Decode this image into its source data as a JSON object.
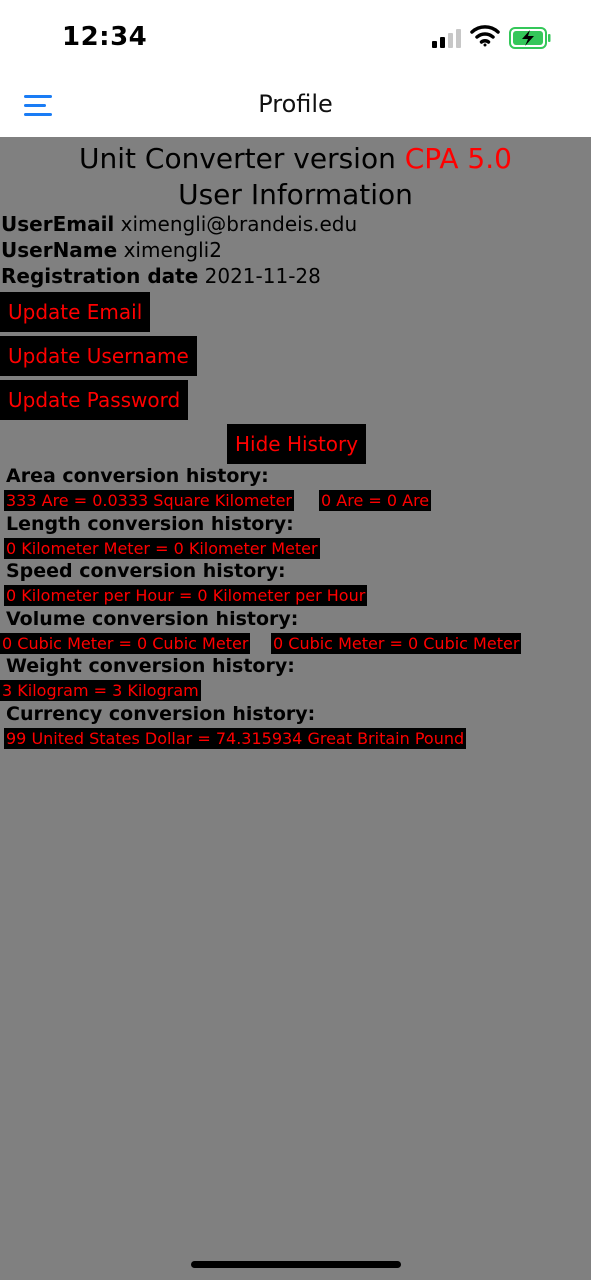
{
  "status_bar": {
    "time": "12:34"
  },
  "nav": {
    "title": "Profile"
  },
  "header": {
    "title_prefix": "Unit Converter version ",
    "version": "CPA 5.0",
    "subtitle": "User Information"
  },
  "user": {
    "email_label": "UserEmail",
    "email": "ximengli@brandeis.edu",
    "name_label": "UserName",
    "name": "ximengli2",
    "date_label": "Registration date",
    "date": "2021-11-28"
  },
  "buttons": {
    "update_email": "Update Email",
    "update_username": "Update Username",
    "update_password": "Update Password",
    "hide_history": "Hide History"
  },
  "history": {
    "area_label": "Area conversion history:",
    "area": [
      "333 Are = 0.0333 Square Kilometer",
      "0 Are = 0 Are"
    ],
    "length_label": "Length conversion history:",
    "length": [
      "0 Kilometer Meter = 0 Kilometer Meter"
    ],
    "speed_label": "Speed conversion history:",
    "speed": [
      "0 Kilometer per Hour = 0 Kilometer per Hour"
    ],
    "volume_label": "Volume conversion history:",
    "volume": [
      "0 Cubic Meter = 0 Cubic Meter",
      "0 Cubic Meter = 0 Cubic Meter"
    ],
    "weight_label": "Weight conversion history:",
    "weight": [
      "3 Kilogram = 3 Kilogram"
    ],
    "currency_label": "Currency conversion history:",
    "currency": [
      "99 United States Dollar = 74.315934 Great Britain Pound"
    ]
  },
  "colors": {
    "background": "#808080",
    "accent_red": "#ff0000",
    "button_bg": "#000000",
    "menu_blue": "#1a7cf5",
    "battery_green": "#34c759"
  }
}
